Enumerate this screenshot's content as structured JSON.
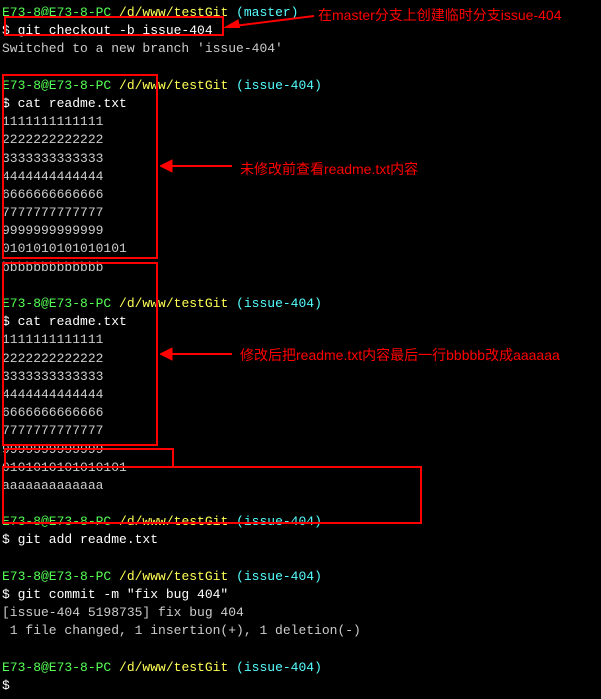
{
  "prompt_user": "E73-8@E73-8-PC",
  "prompt_path": "/d/www/testGit",
  "branch_master": "(master)",
  "branch_issue": "(issue-404)",
  "cmd_checkout": "$ git checkout -b issue-404",
  "msg_switched": "Switched to a new branch 'issue-404'",
  "cmd_cat": "$ cat readme.txt",
  "file_lines_before": [
    "1111111111111",
    "2222222222222",
    "3333333333333",
    "4444444444444",
    "6666666666666",
    "7777777777777",
    "9999999999999",
    "0101010101010101",
    "bbbbbbbbbbbbb"
  ],
  "file_lines_after": [
    "1111111111111",
    "2222222222222",
    "3333333333333",
    "4444444444444",
    "6666666666666",
    "7777777777777",
    "9999999999999",
    "0101010101010101",
    "aaaaaaaaaaaaa"
  ],
  "cmd_add": "$ git add readme.txt",
  "cmd_commit": "$ git commit -m \"fix bug 404\"",
  "msg_commit1": "[issue-404 5198735] fix bug 404",
  "msg_commit2": " 1 file changed, 1 insertion(+), 1 deletion(-)",
  "annot1": "在master分支上创建临时分支issue-404",
  "annot2": "未修改前查看readme.txt内容",
  "annot3": "修改后把readme.txt内容最后一行bbbbb改成aaaaaa",
  "prompt_dollar": "$"
}
